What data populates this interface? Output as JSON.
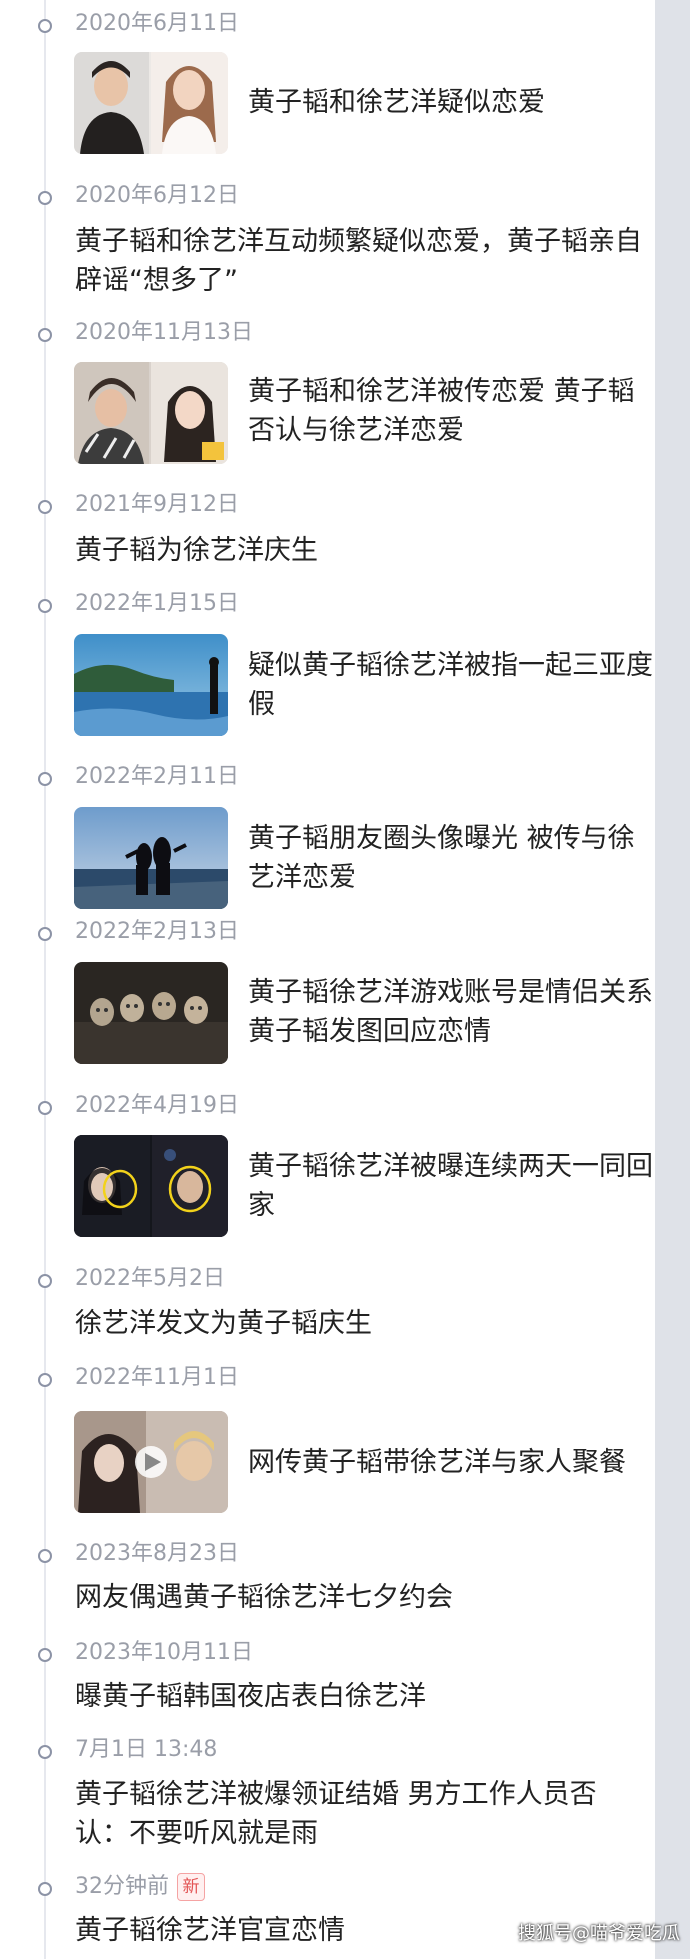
{
  "timeline": {
    "entries": [
      {
        "date": "2020年6月11日",
        "text": "黄子韬和徐艺洋疑似恋爱",
        "image": "photo-pair-portraits"
      },
      {
        "date": "2020年6月12日",
        "text": "黄子韬和徐艺洋互动频繁疑似恋爱，黄子韬亲自辟谣“想多了”"
      },
      {
        "date": "2020年11月13日",
        "text": "黄子韬和徐艺洋被传恋爱 黄子韬否认与徐艺洋恋爱",
        "image": "photo-pair-selfies"
      },
      {
        "date": "2021年9月12日",
        "text": "黄子韬为徐艺洋庆生"
      },
      {
        "date": "2022年1月15日",
        "text": "疑似黄子韬徐艺洋被指一起三亚度假",
        "image": "photo-beach"
      },
      {
        "date": "2022年2月11日",
        "text": "黄子韬朋友圈头像曝光 被传与徐艺洋恋爱",
        "image": "photo-couple-sunset"
      },
      {
        "date": "2022年2月13日",
        "text": "黄子韬徐艺洋游戏账号是情侣关系 黄子韬发图回应恋情",
        "image": "photo-figurines"
      },
      {
        "date": "2022年4月19日",
        "text": "黄子韬徐艺洋被曝连续两天一同回家",
        "image": "photo-night-paparazzi"
      },
      {
        "date": "2022年5月2日",
        "text": "徐艺洋发文为黄子韬庆生"
      },
      {
        "date": "2022年11月1日",
        "text": "网传黄子韬带徐艺洋与家人聚餐",
        "image": "video-thumbnail"
      },
      {
        "date": "2023年8月23日",
        "text": "网友偶遇黄子韬徐艺洋七夕约会"
      },
      {
        "date": "2023年10月11日",
        "text": "曝黄子韬韩国夜店表白徐艺洋"
      },
      {
        "date": "7月1日 13:48",
        "text": "黄子韬徐艺洋被爆领证结婚 男方工作人员否认：不要听风就是雨"
      },
      {
        "date": "32分钟前",
        "badge": "新",
        "text": "黄子韬徐艺洋官宣恋情"
      }
    ]
  },
  "watermark": "搜狐号@喵爷爱吃瓜",
  "colors": {
    "background": "#dfe2e8",
    "card": "#ffffff",
    "date": "#9a9ea8",
    "text": "#222222",
    "dot": "#8c93a6",
    "badge": "#e35555"
  }
}
